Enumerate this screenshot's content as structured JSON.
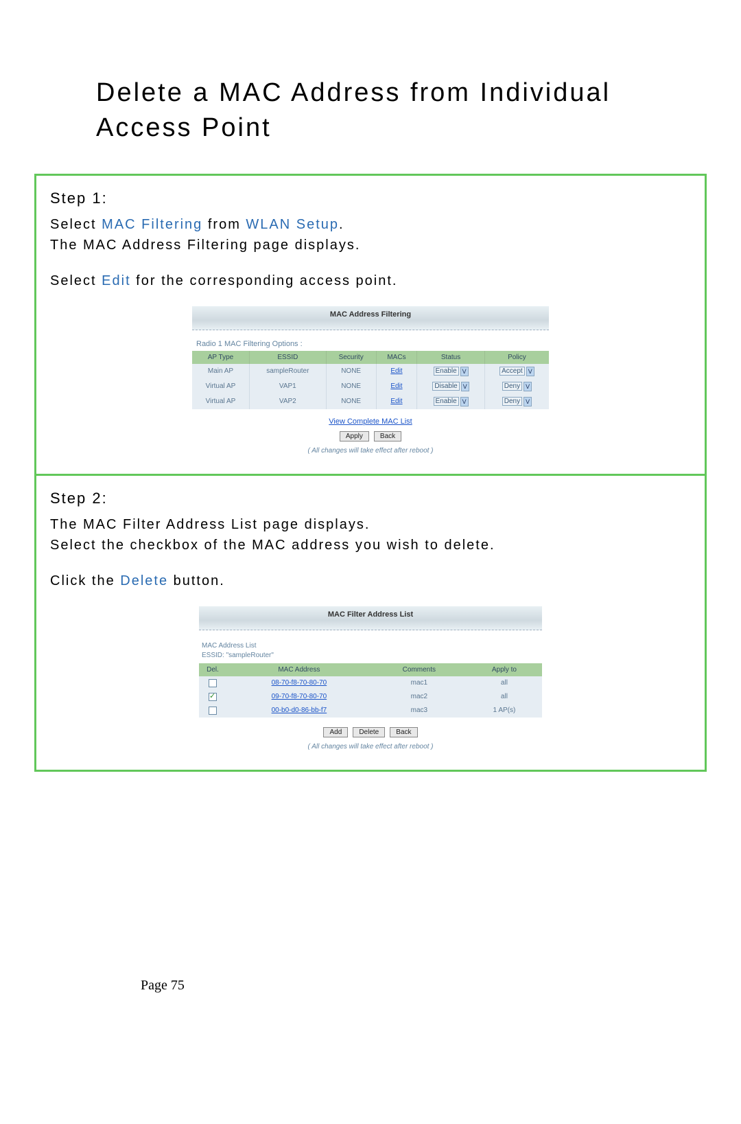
{
  "title": "Delete a MAC Address from Individual Access Point",
  "step1": {
    "heading": "Step 1:",
    "text_pre": "Select ",
    "kw1": "MAC Filtering",
    "mid1": " from ",
    "kw2": "WLAN Setup",
    "mid2": ".",
    "line2": "The MAC Address Filtering page displays.",
    "line3_pre": "Select ",
    "kw3": "Edit",
    "line3_post": " for the corresponding access point."
  },
  "panel1": {
    "title": "MAC Address Filtering",
    "subhead": "Radio 1 MAC Filtering Options :",
    "headers": [
      "AP Type",
      "ESSID",
      "Security",
      "MACs",
      "Status",
      "Policy"
    ],
    "rows": [
      {
        "aptype": "Main AP",
        "essid": "sampleRouter",
        "sec": "NONE",
        "macs": "Edit",
        "status": "Enable",
        "policy": "Accept"
      },
      {
        "aptype": "Virtual AP",
        "essid": "VAP1",
        "sec": "NONE",
        "macs": "Edit",
        "status": "Disable",
        "policy": "Deny"
      },
      {
        "aptype": "Virtual AP",
        "essid": "VAP2",
        "sec": "NONE",
        "macs": "Edit",
        "status": "Enable",
        "policy": "Deny"
      }
    ],
    "viewlink": "View Complete MAC List",
    "btn_apply": "Apply",
    "btn_back": "Back",
    "note": "( All changes will take effect after reboot )"
  },
  "step2": {
    "heading": "Step 2:",
    "line1": "The MAC Filter Address List page displays.",
    "line2": "Select the checkbox of the MAC address you wish to delete.",
    "line3_pre": "Click the ",
    "kw": "Delete",
    "line3_post": " button."
  },
  "panel2": {
    "title": "MAC Filter Address List",
    "blk1": "MAC Address List",
    "blk2": "ESSID: \"sampleRouter\"",
    "headers": [
      "Del.",
      "MAC Address",
      "Comments",
      "Apply to"
    ],
    "rows": [
      {
        "checked": false,
        "mac": "08-70-f8-70-80-70",
        "comments": "mac1",
        "applyto": "all"
      },
      {
        "checked": true,
        "mac": "09-70-f8-70-80-70",
        "comments": "mac2",
        "applyto": "all"
      },
      {
        "checked": false,
        "mac": "00-b0-d0-86-bb-f7",
        "comments": "mac3",
        "applyto": "1 AP(s)"
      }
    ],
    "btn_add": "Add",
    "btn_delete": "Delete",
    "btn_back": "Back",
    "note": "( All changes will take effect after reboot )"
  },
  "page_number": "Page 75"
}
